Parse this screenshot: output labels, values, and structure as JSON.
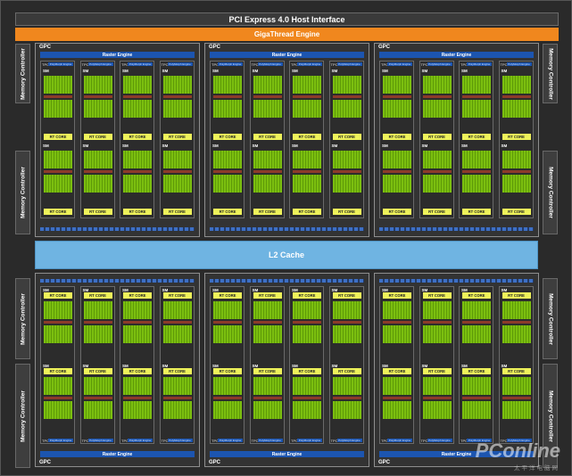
{
  "header": {
    "pci": "PCI Express 4.0 Host Interface",
    "gigathread": "GigaThread Engine"
  },
  "memory_controller": "Memory Controller",
  "l2_cache": "L2 Cache",
  "gpc": {
    "label": "GPC",
    "raster_engine": "Raster Engine"
  },
  "tpc": {
    "label": "TPC",
    "polymorph": "PolyMorph Engine"
  },
  "sm": {
    "label": "SM",
    "rt_core": "RT CORE"
  },
  "watermark": {
    "logo": "PConline",
    "tagline": "太平洋电脑网"
  }
}
